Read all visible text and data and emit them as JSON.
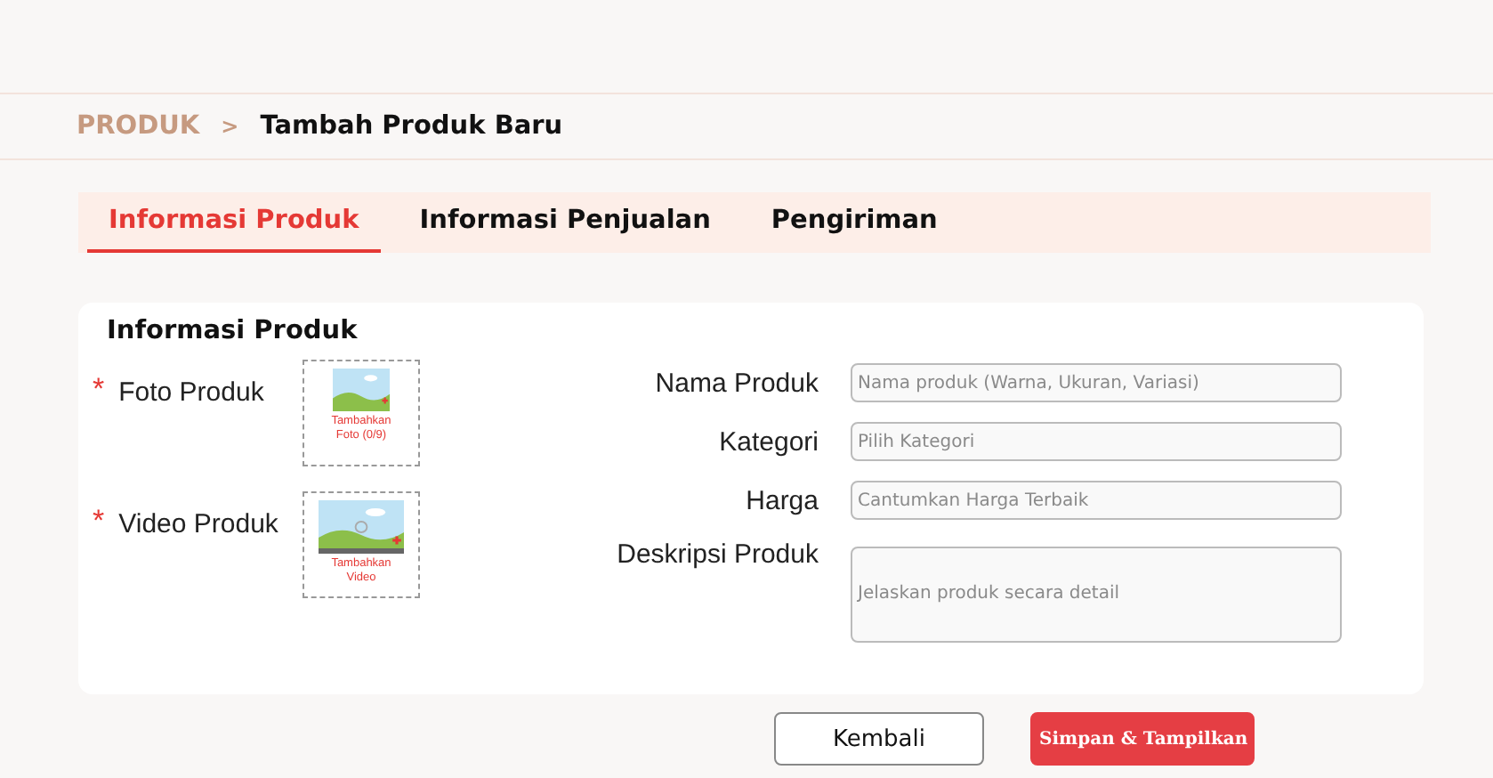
{
  "breadcrumb": {
    "parent": "PRODUK",
    "separator": ">",
    "current": "Tambah Produk Baru"
  },
  "tabs": [
    {
      "label": "Informasi Produk",
      "selected": true
    },
    {
      "label": "Informasi Penjualan",
      "selected": false
    },
    {
      "label": "Pengiriman",
      "selected": false
    }
  ],
  "section_title": "Informasi Produk",
  "media": [
    {
      "label": "Foto Produk",
      "required": true,
      "kind": "photo",
      "action": "Tambahkan Foto (0/9)"
    },
    {
      "label": "Video Produk",
      "required": true,
      "kind": "video",
      "action": "Tambahkan Video"
    }
  ],
  "required_mark": "*",
  "fields": [
    {
      "label": "Nama Produk",
      "placeholder": "Nama produk (Warna, Ukuran, Variasi)",
      "kind": "text"
    },
    {
      "label": "Kategori",
      "placeholder": "Pilih Kategori",
      "kind": "text"
    },
    {
      "label": "Harga",
      "placeholder": "Cantumkan Harga Terbaik",
      "kind": "text"
    },
    {
      "label": "Deskripsi Produk",
      "placeholder": "Jelaskan produk secara detail",
      "kind": "textarea"
    }
  ],
  "buttons": [
    {
      "label": "Kembali",
      "kind": "secondary"
    },
    {
      "label": "Simpan & Tampilkan",
      "kind": "primary"
    }
  ]
}
